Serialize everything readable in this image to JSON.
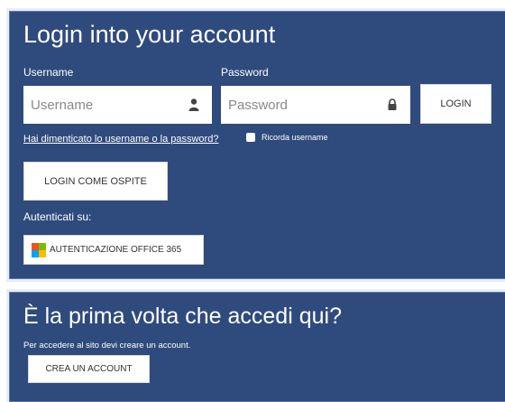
{
  "login": {
    "title": "Login into your account",
    "username_label": "Username",
    "username_placeholder": "Username",
    "password_label": "Password",
    "password_placeholder": "Password",
    "login_button": "LOGIN",
    "forgot_link": "Hai dimenticato lo username o la password?",
    "remember_label": "Ricorda username",
    "guest_button": "LOGIN COME OSPITE",
    "auth_label": "Autenticati su:",
    "office_button": "AUTENTICAZIONE OFFICE 365"
  },
  "signup": {
    "title": "È la prima volta che accedi qui?",
    "text": "Per accedere al sito devi creare un account.",
    "create_button": "CREA UN ACCOUNT"
  },
  "icons": {
    "username": "user-icon",
    "password": "lock-icon",
    "office": "microsoft-logo-icon"
  },
  "colors": {
    "panel_bg": "#2f4b7d",
    "ms_red": "#f25022",
    "ms_green": "#7fba00",
    "ms_blue": "#00a4ef",
    "ms_yellow": "#ffb900"
  }
}
